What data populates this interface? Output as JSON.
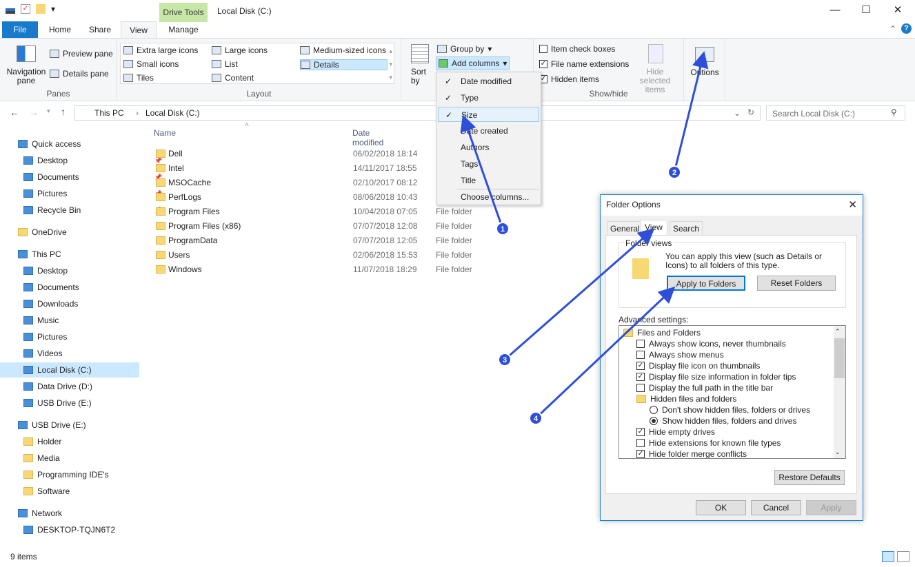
{
  "window": {
    "title": "Local Disk (C:)",
    "context_tab": "Drive Tools",
    "minimize": "—",
    "maximize": "☐",
    "close": "✕"
  },
  "tabs": [
    "File",
    "Home",
    "Share",
    "View",
    "Manage"
  ],
  "ribbon": {
    "panes": {
      "label": "Panes",
      "navigation_pane": "Navigation pane",
      "preview_pane": "Preview pane",
      "details_pane": "Details pane"
    },
    "layout": {
      "label": "Layout",
      "items": [
        "Extra large icons",
        "Large icons",
        "Medium-sized icons",
        "Small icons",
        "List",
        "Details",
        "Tiles",
        "Content"
      ],
      "selected": "Details"
    },
    "current_view": {
      "sort_by": "Sort by",
      "group_by": "Group by",
      "add_columns": "Add columns"
    },
    "show_hide": {
      "label": "Show/hide",
      "item_check_boxes": "Item check boxes",
      "file_name_extensions": "File name extensions",
      "hidden_items": "Hidden items",
      "hide_selected": "Hide selected items"
    },
    "options": "Options"
  },
  "address": {
    "path": [
      "This PC",
      "Local Disk (C:)"
    ],
    "search_placeholder": "Search Local Disk (C:)"
  },
  "nav": [
    {
      "label": "Quick access",
      "icon": "star-icon",
      "indent": 0
    },
    {
      "label": "Desktop",
      "icon": "desktop-icon",
      "indent": 1,
      "pinned": true
    },
    {
      "label": "Documents",
      "icon": "documents-icon",
      "indent": 1,
      "pinned": true
    },
    {
      "label": "Pictures",
      "icon": "pictures-icon",
      "indent": 1,
      "pinned": true
    },
    {
      "label": "Recycle Bin",
      "icon": "recycle-bin-icon",
      "indent": 1,
      "pinned": true
    },
    {
      "label": "OneDrive",
      "icon": "folder-icon",
      "indent": 0
    },
    {
      "label": "This PC",
      "icon": "computer-icon",
      "indent": 0
    },
    {
      "label": "Desktop",
      "icon": "desktop-icon",
      "indent": 1
    },
    {
      "label": "Documents",
      "icon": "documents-icon",
      "indent": 1
    },
    {
      "label": "Downloads",
      "icon": "downloads-icon",
      "indent": 1
    },
    {
      "label": "Music",
      "icon": "music-icon",
      "indent": 1
    },
    {
      "label": "Pictures",
      "icon": "pictures-icon",
      "indent": 1
    },
    {
      "label": "Videos",
      "icon": "videos-icon",
      "indent": 1
    },
    {
      "label": "Local Disk (C:)",
      "icon": "drive-icon",
      "indent": 1,
      "selected": true
    },
    {
      "label": "Data Drive (D:)",
      "icon": "drive-icon",
      "indent": 1
    },
    {
      "label": "USB Drive (E:)",
      "icon": "drive-icon",
      "indent": 1
    },
    {
      "label": "USB Drive (E:)",
      "icon": "drive-icon",
      "indent": 0
    },
    {
      "label": "Holder",
      "icon": "folder-icon",
      "indent": 1
    },
    {
      "label": "Media",
      "icon": "folder-icon",
      "indent": 1
    },
    {
      "label": "Programming IDE's",
      "icon": "folder-icon",
      "indent": 1
    },
    {
      "label": "Software",
      "icon": "folder-icon",
      "indent": 1
    },
    {
      "label": "Network",
      "icon": "network-icon",
      "indent": 0
    },
    {
      "label": "DESKTOP-TQJN6T2",
      "icon": "computer-icon",
      "indent": 1
    }
  ],
  "columns": [
    "Name",
    "Date modified"
  ],
  "files": [
    {
      "name": "Dell",
      "date": "06/02/2018 18:14",
      "type": ""
    },
    {
      "name": "Intel",
      "date": "14/11/2017 18:55",
      "type": ""
    },
    {
      "name": "MSOCache",
      "date": "02/10/2017 08:12",
      "type": ""
    },
    {
      "name": "PerfLogs",
      "date": "08/06/2018 10:43",
      "type": ""
    },
    {
      "name": "Program Files",
      "date": "10/04/2018 07:05",
      "type": "File folder"
    },
    {
      "name": "Program Files (x86)",
      "date": "07/07/2018 12:08",
      "type": "File folder"
    },
    {
      "name": "ProgramData",
      "date": "07/07/2018 12:05",
      "type": "File folder"
    },
    {
      "name": "Users",
      "date": "02/06/2018 15:53",
      "type": "File folder"
    },
    {
      "name": "Windows",
      "date": "11/07/2018 18:29",
      "type": "File folder"
    }
  ],
  "column_menu": [
    {
      "label": "Date modified",
      "checked": true
    },
    {
      "label": "Type",
      "checked": true
    },
    {
      "label": "Size",
      "checked": true,
      "highlighted": true
    },
    {
      "label": "Date created",
      "checked": false
    },
    {
      "label": "Authors",
      "checked": false
    },
    {
      "label": "Tags",
      "checked": false
    },
    {
      "label": "Title",
      "checked": false
    },
    {
      "label": "Choose columns...",
      "checked": false
    }
  ],
  "dialog": {
    "title": "Folder Options",
    "tabs": [
      "General",
      "View",
      "Search"
    ],
    "active_tab": "View",
    "folder_views_label": "Folder views",
    "folder_views_text": "You can apply this view (such as Details or Icons) to all folders of this type.",
    "apply_to_folders": "Apply to Folders",
    "reset_folders": "Reset Folders",
    "advanced_label": "Advanced settings:",
    "advanced": [
      {
        "label": "Files and Folders",
        "kind": "folder",
        "level": 0
      },
      {
        "label": "Always show icons, never thumbnails",
        "kind": "checkbox",
        "checked": false,
        "level": 1
      },
      {
        "label": "Always show menus",
        "kind": "checkbox",
        "checked": false,
        "level": 1
      },
      {
        "label": "Display file icon on thumbnails",
        "kind": "checkbox",
        "checked": true,
        "level": 1
      },
      {
        "label": "Display file size information in folder tips",
        "kind": "checkbox",
        "checked": true,
        "level": 1
      },
      {
        "label": "Display the full path in the title bar",
        "kind": "checkbox",
        "checked": false,
        "level": 1
      },
      {
        "label": "Hidden files and folders",
        "kind": "folder",
        "level": 1
      },
      {
        "label": "Don't show hidden files, folders or drives",
        "kind": "radio",
        "checked": false,
        "level": 2
      },
      {
        "label": "Show hidden files, folders and drives",
        "kind": "radio",
        "checked": true,
        "level": 2
      },
      {
        "label": "Hide empty drives",
        "kind": "checkbox",
        "checked": true,
        "level": 1
      },
      {
        "label": "Hide extensions for known file types",
        "kind": "checkbox",
        "checked": false,
        "level": 1
      },
      {
        "label": "Hide folder merge conflicts",
        "kind": "checkbox",
        "checked": true,
        "level": 1
      }
    ],
    "restore_defaults": "Restore Defaults",
    "ok": "OK",
    "cancel": "Cancel",
    "apply": "Apply"
  },
  "annotations": [
    "1",
    "2",
    "3",
    "4"
  ],
  "annotation_color": "#2f4fd8",
  "status": {
    "items": "9 items"
  }
}
